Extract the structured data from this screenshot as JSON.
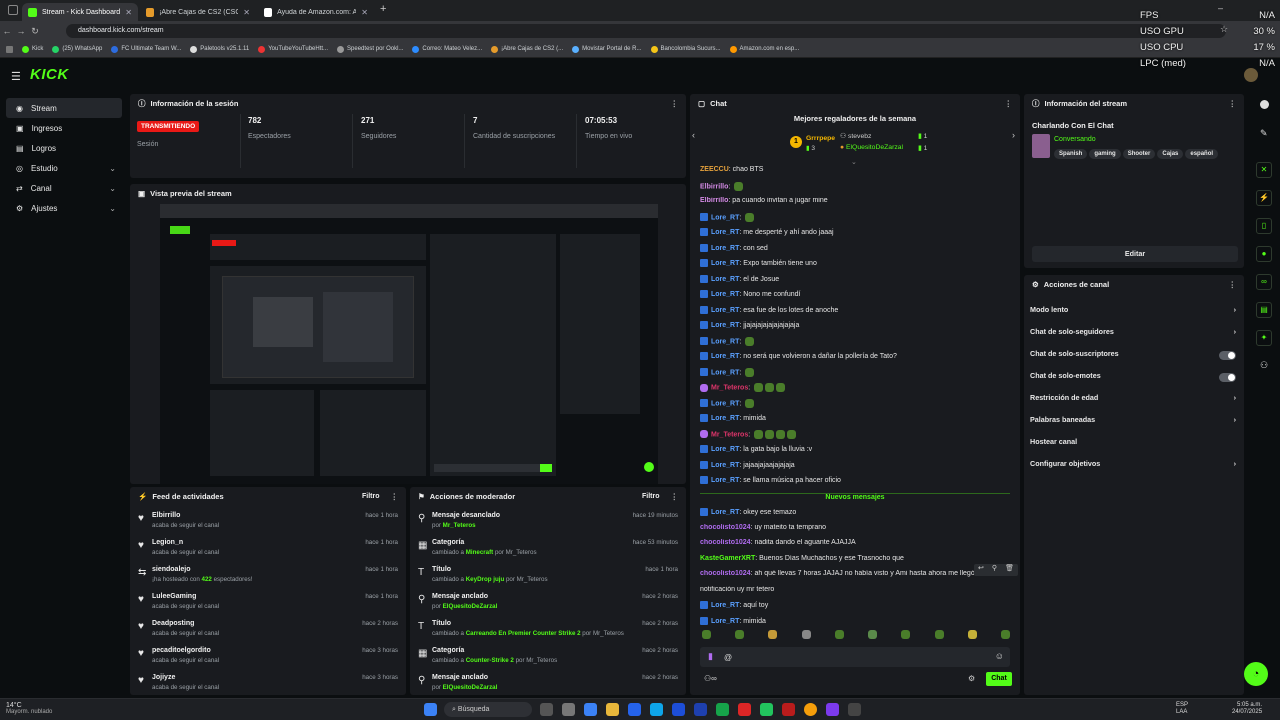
{
  "browser": {
    "tabs": [
      {
        "title": "Stream - Kick Dashboard",
        "color": "#53fc18"
      },
      {
        "title": "¡Abre Cajas de CS2 (CSGO), Ga",
        "color": "#e59b2b"
      },
      {
        "title": "Ayuda de Amazon.com: Ayuda",
        "color": "#ffffff"
      }
    ],
    "url": "dashboard.kick.com/stream",
    "bookmarks": [
      "Kick",
      "(25) WhatsApp",
      "FC Ultimate Team W...",
      "Paletools v25.1.11",
      "YouTubeYouTubeHtt...",
      "Speedtest por Ookl...",
      "Correo: Mateo Velez...",
      "¡Abre Cajas de CS2 (...",
      "Movistar Portal de R...",
      "Bancolombia Sucurs...",
      "Amazon.com en esp..."
    ]
  },
  "overlay": {
    "rows": [
      [
        "FPS",
        "N/A"
      ],
      [
        "USO GPU",
        "30 %"
      ],
      [
        "USO CPU",
        "17 %"
      ],
      [
        "LPC (med)",
        "N/A"
      ]
    ]
  },
  "logo": "KICK",
  "sidebar": {
    "items": [
      {
        "label": "Stream",
        "icon": "broadcast-icon",
        "active": true
      },
      {
        "label": "Ingresos",
        "icon": "money-icon"
      },
      {
        "label": "Logros",
        "icon": "trophy-icon"
      },
      {
        "label": "Estudio",
        "icon": "studio-icon",
        "chev": true
      },
      {
        "label": "Canal",
        "icon": "channel-icon",
        "chev": true
      },
      {
        "label": "Ajustes",
        "icon": "gear-icon",
        "chev": true
      }
    ]
  },
  "session": {
    "title": "Información de la sesión",
    "live_badge": "TRANSMITIENDO",
    "session_label": "Sesión",
    "stats": [
      {
        "value": "782",
        "label": "Espectadores"
      },
      {
        "value": "271",
        "label": "Seguidores"
      },
      {
        "value": "7",
        "label": "Cantidad de suscripciones"
      },
      {
        "value": "07:05:53",
        "label": "Tiempo en vivo"
      }
    ]
  },
  "preview": {
    "title": "Vista previa del stream"
  },
  "activity": {
    "title": "Feed de actividades",
    "filter": "Filtro",
    "items": [
      {
        "name": "Elbirrillo",
        "sub": "acaba de seguir el canal",
        "time": "hace 1 hora",
        "icon": "heart-icon"
      },
      {
        "name": "Legion_n",
        "sub": "acaba de seguir el canal",
        "time": "hace 1 hora",
        "icon": "heart-icon"
      },
      {
        "name": "siendoalejo",
        "sub_pre": "¡ha hosteado con ",
        "sub_hl": "422",
        "sub_post": " espectadores!",
        "time": "hace 1 hora",
        "icon": "host-icon"
      },
      {
        "name": "LuleeGaming",
        "sub": "acaba de seguir el canal",
        "time": "hace 1 hora",
        "icon": "heart-icon"
      },
      {
        "name": "Deadposting",
        "sub": "acaba de seguir el canal",
        "time": "hace 2 horas",
        "icon": "heart-icon"
      },
      {
        "name": "pecaditoelgordito",
        "sub": "acaba de seguir el canal",
        "time": "hace 3 horas",
        "icon": "heart-icon"
      },
      {
        "name": "Jojiyze",
        "sub": "acaba de seguir el canal",
        "time": "hace 3 horas",
        "icon": "heart-icon"
      }
    ]
  },
  "modactions": {
    "title": "Acciones de moderador",
    "filter": "Filtro",
    "items": [
      {
        "name": "Mensaje desanclado",
        "pre": "por ",
        "hl": "Mr_Teteros",
        "post": "",
        "time": "hace 19 minutos",
        "icon": "unpin-icon"
      },
      {
        "name": "Categoría",
        "pre": "cambiado a ",
        "hl": "Minecraft",
        "post": " por Mr_Teteros",
        "time": "hace 53 minutos",
        "icon": "category-icon"
      },
      {
        "name": "Título",
        "pre": "cambiado a ",
        "hl": "KeyDrop juju",
        "post": " por Mr_Teteros",
        "time": "hace 1 hora",
        "icon": "title-icon"
      },
      {
        "name": "Mensaje anclado",
        "pre": "por ",
        "hl": "ElQuesitoDeZarzal",
        "post": "",
        "time": "hace 2 horas",
        "icon": "pin-icon"
      },
      {
        "name": "Título",
        "pre": "cambiado a ",
        "hl": "Carreando En Premier Counter Strike 2",
        "post": " por Mr_Teteros",
        "time": "hace 2 horas",
        "icon": "title-icon"
      },
      {
        "name": "Categoría",
        "pre": "cambiado a ",
        "hl": "Counter-Strike 2",
        "post": " por Mr_Teteros",
        "time": "hace 2 horas",
        "icon": "category-icon"
      },
      {
        "name": "Mensaje anclado",
        "pre": "por ",
        "hl": "ElQuesitoDeZarzal",
        "post": "",
        "time": "hace 2 horas",
        "icon": "pin-icon"
      }
    ]
  },
  "chat": {
    "title": "Chat",
    "gifters_title": "Mejores regaladores de la semana",
    "gifters": [
      {
        "name": "Grrrpepe",
        "count": "3"
      },
      {
        "name": "stevebz",
        "count": "1"
      },
      {
        "name": "ElQuesitoDeZarzal",
        "count": "1"
      }
    ],
    "messages": [
      {
        "user": "ZEECCU",
        "color": "#e6a23c",
        "text": "chao BTS"
      },
      {
        "user": "Elbirrillo",
        "color": "#d58be6",
        "text": "",
        "emotes": 1
      },
      {
        "user": "Elbirrillo",
        "color": "#d58be6",
        "text": "pa cuando invitan a jugar mine"
      },
      {
        "user": "Lore_RT",
        "color": "#5aa0ff",
        "text": "",
        "mod": true,
        "emotes": 1
      },
      {
        "user": "Lore_RT",
        "color": "#5aa0ff",
        "text": "me desperté y ahí ando jaaaj",
        "mod": true
      },
      {
        "user": "Lore_RT",
        "color": "#5aa0ff",
        "text": "con sed",
        "mod": true
      },
      {
        "user": "Lore_RT",
        "color": "#5aa0ff",
        "text": "Expo también tiene uno",
        "mod": true
      },
      {
        "user": "Lore_RT",
        "color": "#5aa0ff",
        "text": "el de Josue",
        "mod": true
      },
      {
        "user": "Lore_RT",
        "color": "#5aa0ff",
        "text": "Nono me confundí",
        "mod": true
      },
      {
        "user": "Lore_RT",
        "color": "#5aa0ff",
        "text": "esa fue de los lotes de anoche",
        "mod": true
      },
      {
        "user": "Lore_RT",
        "color": "#5aa0ff",
        "text": "jjajajajajajajajajaja",
        "mod": true
      },
      {
        "user": "Lore_RT",
        "color": "#5aa0ff",
        "text": "",
        "mod": true,
        "emotes": 1
      },
      {
        "user": "Lore_RT",
        "color": "#5aa0ff",
        "text": "no será que volvieron a dañar la pollería de Tato?",
        "mod": true
      },
      {
        "user": "Lore_RT",
        "color": "#5aa0ff",
        "text": "",
        "mod": true,
        "emotes": 1
      },
      {
        "user": "Mr_Teteros",
        "color": "#e0356b",
        "text": "",
        "mic": true,
        "emotes": 3
      },
      {
        "user": "Lore_RT",
        "color": "#5aa0ff",
        "text": "",
        "mod": true,
        "emotes": 1
      },
      {
        "user": "Lore_RT",
        "color": "#5aa0ff",
        "text": "mimida",
        "mod": true
      },
      {
        "user": "Mr_Teteros",
        "color": "#e0356b",
        "text": "",
        "mic": true,
        "emotes": 4
      },
      {
        "user": "Lore_RT",
        "color": "#5aa0ff",
        "text": "la gata bajo la lluvia :v",
        "mod": true
      },
      {
        "user": "Lore_RT",
        "color": "#5aa0ff",
        "text": "jajaajajaajajajaja",
        "mod": true
      },
      {
        "user": "Lore_RT",
        "color": "#5aa0ff",
        "text": "se llama música pa hacer oficio",
        "mod": true
      }
    ],
    "new_label": "Nuevos mensajes",
    "new_messages": [
      {
        "user": "Lore_RT",
        "color": "#5aa0ff",
        "text": "okey ese temazo",
        "mod": true
      },
      {
        "user": "chocolisto1024",
        "color": "#b06cf0",
        "text": "uy mateito ta temprano"
      },
      {
        "user": "chocolisto1024",
        "color": "#b06cf0",
        "text": "nadita dando el aguante AJAJJA"
      },
      {
        "user": "KasteGamerXRT",
        "color": "#53fc18",
        "text": "Buenos Días Muchachos y ese Trasnocho que"
      },
      {
        "user": "chocolisto1024",
        "color": "#b06cf0",
        "text": "ah qué llevas 7 horas JAJAJ no había visto y Ami hasta ahora me llegó la"
      },
      {
        "user": "",
        "color": "#e6e6e6",
        "text": "notificación uy mr tetero"
      },
      {
        "user": "Lore_RT",
        "color": "#5aa0ff",
        "text": "aquí toy",
        "mod": true
      },
      {
        "user": "Lore_RT",
        "color": "#5aa0ff",
        "text": "mimida",
        "mod": true
      }
    ],
    "input_value": "@",
    "send_label": "Chat"
  },
  "stream_info": {
    "title": "Información del stream",
    "stream_title": "Charlando Con El Chat",
    "category": "Conversando",
    "tags": [
      "Spanish",
      "gaming",
      "Shooter",
      "Cajas",
      "español"
    ],
    "edit_label": "Editar"
  },
  "channel_actions": {
    "title": "Acciones de canal",
    "items": [
      {
        "label": "Modo lento",
        "control": "chevron"
      },
      {
        "label": "Chat de solo-seguidores",
        "control": "chevron"
      },
      {
        "label": "Chat de solo-suscriptores",
        "control": "toggle"
      },
      {
        "label": "Chat de solo-emotes",
        "control": "toggle"
      },
      {
        "label": "Restricción de edad",
        "control": "chevron"
      },
      {
        "label": "Palabras baneadas",
        "control": "chevron"
      },
      {
        "label": "Hostear canal",
        "control": "none"
      },
      {
        "label": "Configurar objetivos",
        "control": "chevron"
      }
    ]
  },
  "taskbar": {
    "weather_temp": "14°C",
    "weather_desc": "Mayorm. nublado",
    "search": "Búsqueda",
    "lang1": "ESP",
    "lang2": "LAA",
    "time": "5:05 a.m.",
    "date": "24/07/2025"
  },
  "colors": {
    "accent": "#53fc18",
    "live": "#e91916",
    "panel": "#191b1f",
    "bg": "#0b0e10"
  }
}
